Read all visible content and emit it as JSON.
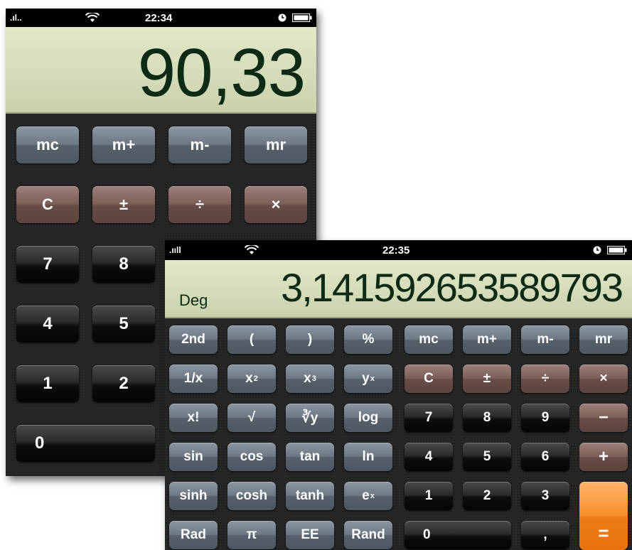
{
  "portrait": {
    "status": {
      "time": "22:34",
      "signal": ".ıl..",
      "wifi_icon": "wifi-icon",
      "clock_icon": "clock-icon",
      "battery_icon": "battery-icon"
    },
    "display": "90,33",
    "keys": {
      "mc": "mc",
      "mplus": "m+",
      "mminus": "m-",
      "mr": "mr",
      "c": "C",
      "plusminus": "±",
      "divide": "÷",
      "times": "×",
      "seven": "7",
      "eight": "8",
      "four": "4",
      "five": "5",
      "one": "1",
      "two": "2",
      "zero": "0"
    }
  },
  "landscape": {
    "status": {
      "time": "22:35",
      "signal": ".ııll",
      "wifi_icon": "wifi-icon",
      "clock_icon": "clock-icon",
      "battery_icon": "battery-icon"
    },
    "display": "3,141592653589793",
    "angle_mode": "Deg",
    "keys": {
      "second": "2nd",
      "lparen": "(",
      "rparen": ")",
      "percent": "%",
      "mc": "mc",
      "mplus": "m+",
      "mminus": "m-",
      "mr": "mr",
      "recip": "1/x",
      "x2": "x",
      "x2_sup": "2",
      "x3": "x",
      "x3_sup": "3",
      "yx": "y",
      "yx_sup": "x",
      "c": "C",
      "plusminus": "±",
      "divide": "÷",
      "times": "×",
      "fact": "x!",
      "sqrt": "√",
      "xrooty": "∛y",
      "log": "log",
      "seven": "7",
      "eight": "8",
      "nine": "9",
      "minus": "−",
      "sin": "sin",
      "cos": "cos",
      "tan": "tan",
      "ln": "ln",
      "four": "4",
      "five": "5",
      "six": "6",
      "plus": "+",
      "sinh": "sinh",
      "cosh": "cosh",
      "tanh": "tanh",
      "ex": "e",
      "ex_sup": "x",
      "one": "1",
      "two": "2",
      "three": "3",
      "equals": "=",
      "rad": "Rad",
      "pi": "π",
      "ee": "EE",
      "rand": "Rand",
      "zero": "0",
      "comma": ","
    }
  }
}
